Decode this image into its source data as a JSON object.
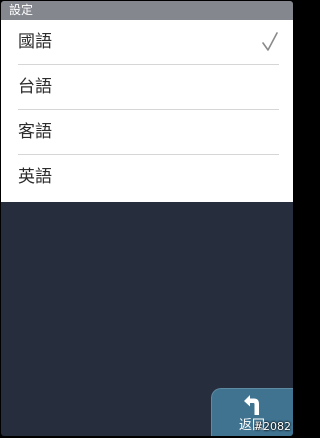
{
  "header": {
    "title": "設定"
  },
  "languages": [
    {
      "label": "國語",
      "selected": true
    },
    {
      "label": "台語",
      "selected": false
    },
    {
      "label": "客語",
      "selected": false
    },
    {
      "label": "英語",
      "selected": false
    }
  ],
  "footer": {
    "back_label": "返回",
    "screen_id": "#2082"
  },
  "colors": {
    "title_bar": "#85878f",
    "background": "#262d3d",
    "back_button": "#3f7390"
  }
}
